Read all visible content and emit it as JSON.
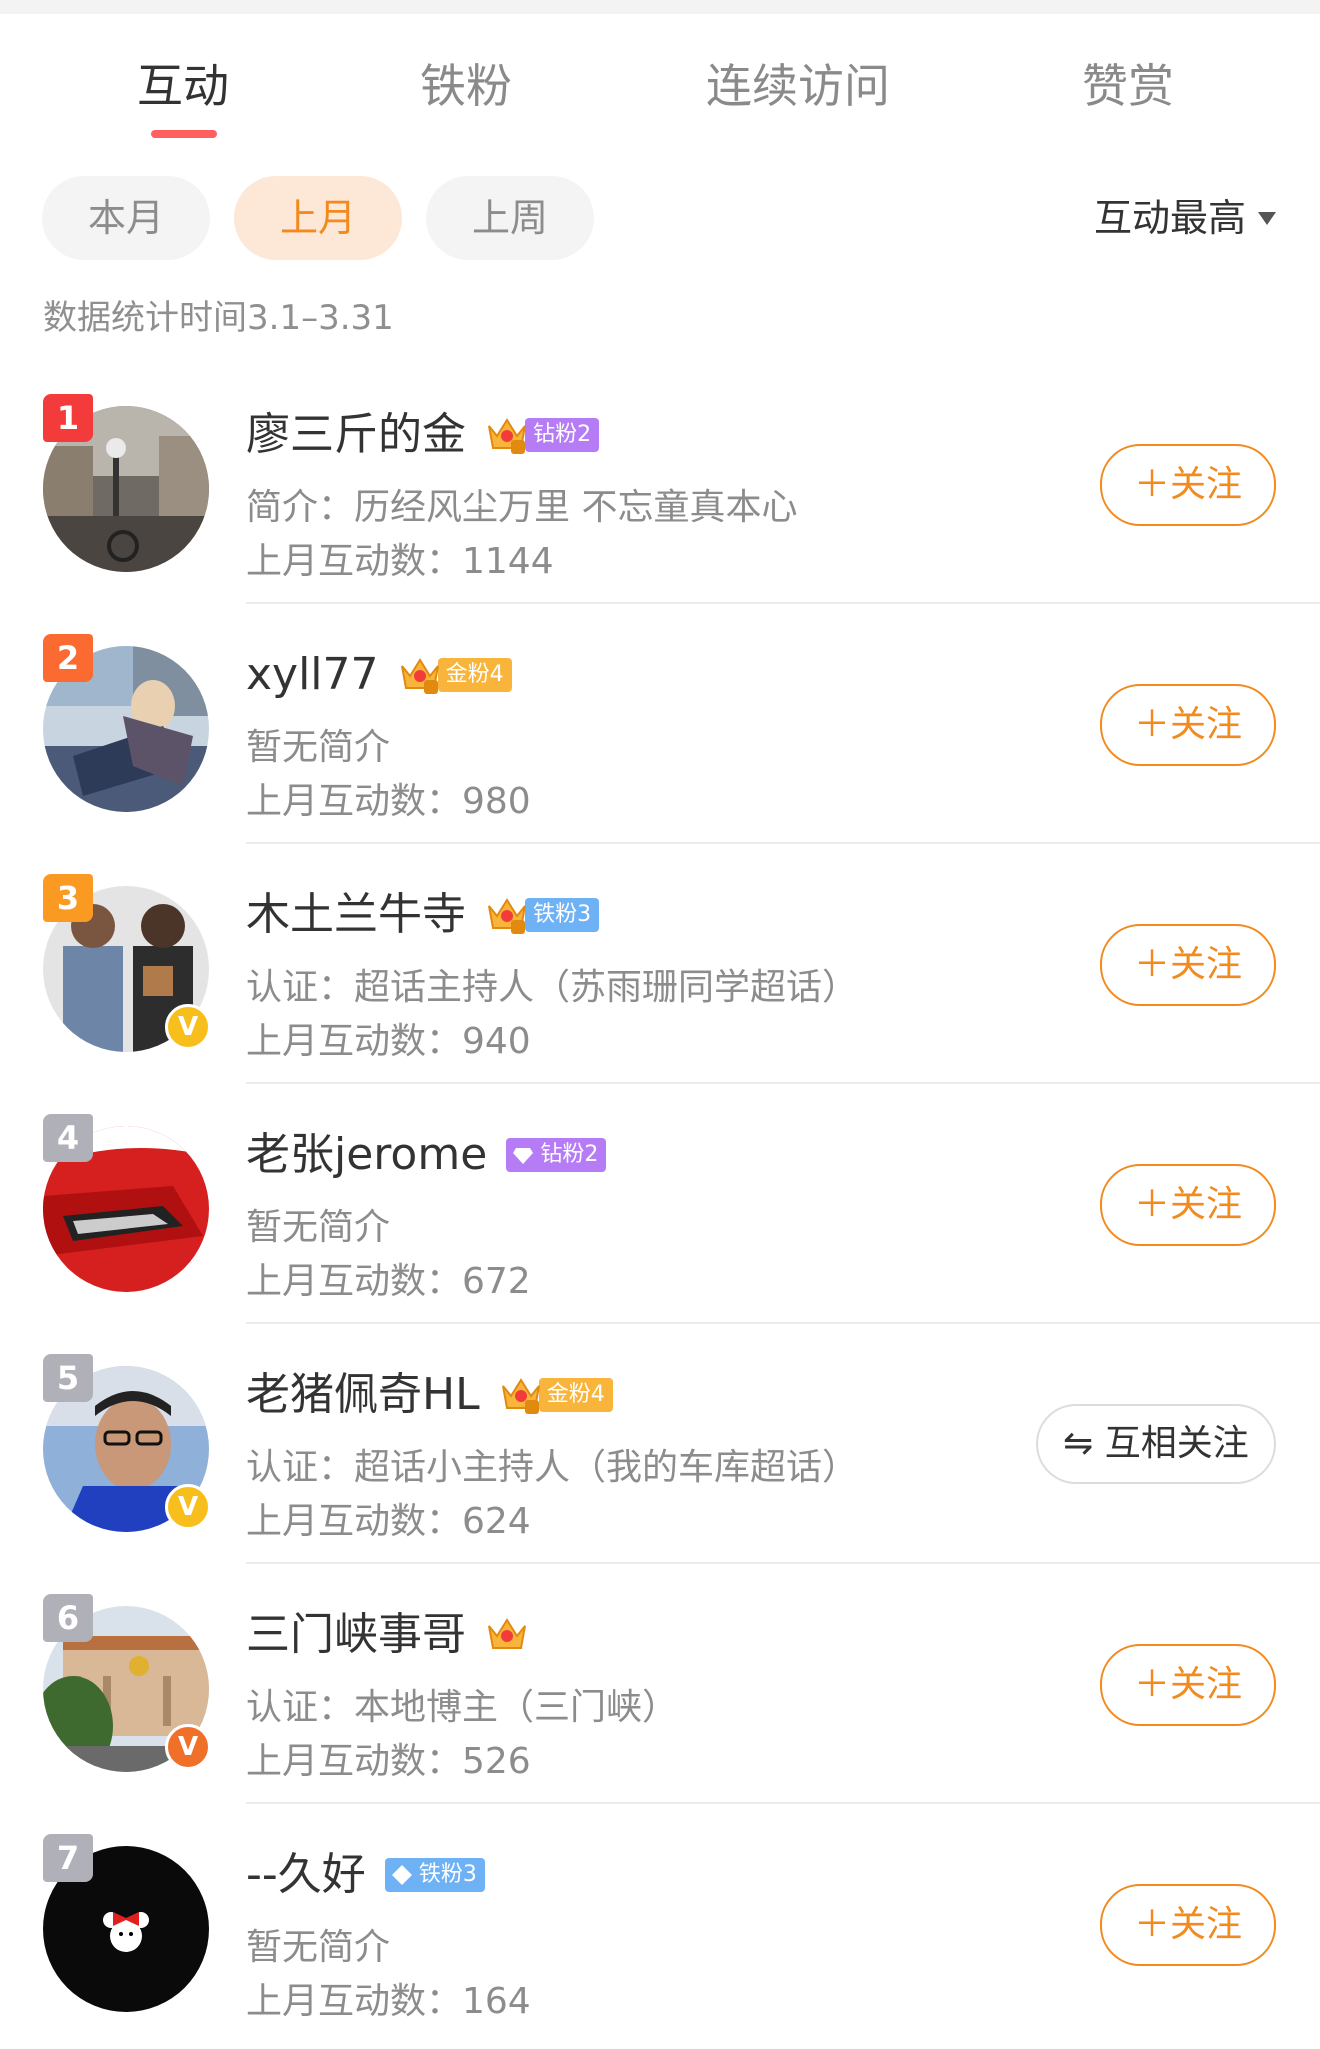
{
  "tabs": [
    {
      "label": "互动",
      "active": true
    },
    {
      "label": "铁粉",
      "active": false
    },
    {
      "label": "连续访问",
      "active": false
    },
    {
      "label": "赞赏",
      "active": false
    }
  ],
  "filters": [
    {
      "label": "本月",
      "active": false
    },
    {
      "label": "上月",
      "active": true
    },
    {
      "label": "上周",
      "active": false
    }
  ],
  "sort_label": "互动最高",
  "period_text": "数据统计时间3.1–3.31",
  "users": [
    {
      "rank": "1",
      "name": "廖三斤的金",
      "badge": "钻粉2",
      "badge_level": "6",
      "desc": "简介：历经风尘万里 不忘童真本心",
      "count": "上月互动数：1144",
      "button": "＋关注"
    },
    {
      "rank": "2",
      "name": "xyll77",
      "badge": "金粉4",
      "badge_level": "6",
      "desc": "暂无简介",
      "count": "上月互动数：980",
      "button": "＋关注"
    },
    {
      "rank": "3",
      "name": "木土兰牛寺",
      "badge": "铁粉3",
      "badge_level": "6",
      "desc": "认证：超话主持人（苏雨珊同学超话）",
      "count": "上月互动数：940",
      "button": "＋关注"
    },
    {
      "rank": "4",
      "name": "老张jerome",
      "badge": "钻粉2",
      "desc": "暂无简介",
      "count": "上月互动数：672",
      "button": "＋关注"
    },
    {
      "rank": "5",
      "name": "老猪佩奇HL",
      "badge": "金粉4",
      "badge_level": "3",
      "desc": "认证：超话小主持人（我的车库超话）",
      "count": "上月互动数：624",
      "button": "互相关注"
    },
    {
      "rank": "6",
      "name": "三门峡事哥",
      "desc": "认证：本地博主（三门峡）",
      "count": "上月互动数：526",
      "button": "＋关注"
    },
    {
      "rank": "7",
      "name": "--久好",
      "badge": "铁粉3",
      "desc": "暂无简介",
      "count": "上月互动数：164",
      "button": "＋关注"
    }
  ],
  "colors": {
    "accent": "#f28a1e",
    "tab_indicator": "#ff5f5f",
    "rank1": "#f43b3b",
    "rank2": "#fb6a30",
    "rank3": "#fb9a22",
    "rank_other": "#b0b0b8",
    "diamond_badge": "#b57cf5",
    "gold_badge": "#f9b53b",
    "iron_badge": "#6fb1f5",
    "verified_yellow": "#f8bf1c",
    "verified_orange": "#f0702a"
  }
}
